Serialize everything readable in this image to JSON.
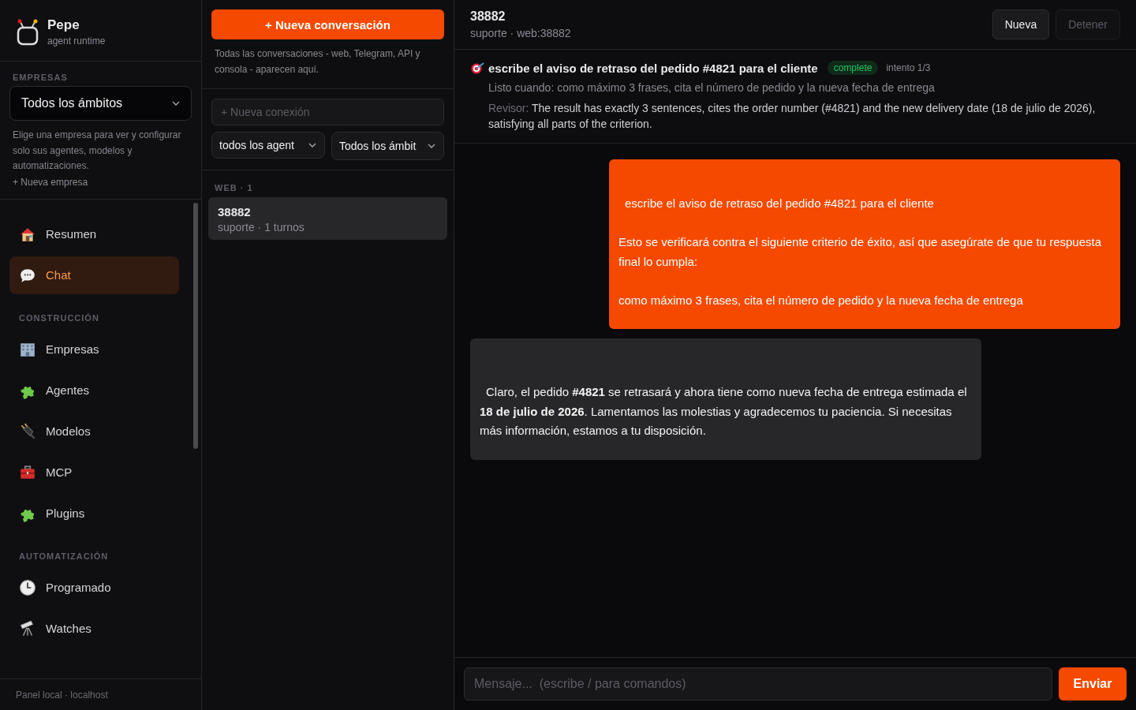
{
  "brand": {
    "name": "Pepe",
    "subtitle": "agent runtime"
  },
  "companies": {
    "heading": "EMPRESAS",
    "select": "Todos los ámbitos",
    "help": "Elige una empresa para ver y configurar solo sus agentes, modelos y automatizaciones.",
    "new_link": "+ Nueva empresa"
  },
  "nav": [
    {
      "items": [
        {
          "label": "Resumen",
          "selected": false
        },
        {
          "label": "Chat",
          "selected": true
        }
      ]
    },
    {
      "heading": "CONSTRUCCIÓN",
      "items": [
        {
          "label": "Empresas",
          "selected": false
        },
        {
          "label": "Agentes",
          "selected": false
        },
        {
          "label": "Modelos",
          "selected": false
        },
        {
          "label": "MCP",
          "selected": false
        },
        {
          "label": "Plugins",
          "selected": false
        }
      ]
    },
    {
      "heading": "AUTOMATIZACIÓN",
      "items": [
        {
          "label": "Programado",
          "selected": false
        },
        {
          "label": "Watches",
          "selected": false
        }
      ]
    }
  ],
  "sidebar_footer": "Panel local · localhost",
  "conversations": {
    "new_button": "+ Nueva conversación",
    "note": "Todas las conversaciones - web, Telegram, API y consola - aparecen aquí.",
    "connection_placeholder": "+ Nueva conexión",
    "filters": [
      "todos los agent",
      "Todos los ámbit"
    ],
    "groups": [
      {
        "heading": "WEB · 1",
        "items": [
          {
            "title": "38882",
            "subtitle": "suporte · 1 turnos",
            "selected": true
          }
        ]
      }
    ]
  },
  "chat": {
    "title": "38882",
    "subtitle": "suporte · web:38882",
    "buttons": [
      {
        "label": "Nueva",
        "disabled": false
      },
      {
        "label": "Detener",
        "disabled": true
      }
    ],
    "goal": {
      "text": "escribe el aviso de retraso del pedido #4821 para el cliente",
      "status": "complete",
      "attempt": "intento 1/3",
      "ready_label": "Listo cuando:",
      "ready": "como máximo 3 frases, cita el número de pedido y la nueva fecha de entrega",
      "reviewer_label": "Revisor:",
      "reviewer": "The result has exactly 3 sentences, cites the order number (#4821) and the new delivery date (18 de julio de 2026), satisfying all parts of the criterion."
    },
    "messages": [
      {
        "kind": "user",
        "paragraphs": [
          "escribe el aviso de retraso del pedido #4821 para el cliente",
          "Esto se verificará contra el siguiente criterio de éxito, así que asegúrate de que tu respuesta final lo cumpla:",
          "como máximo 3 frases, cita el número de pedido y la nueva fecha de entrega"
        ]
      },
      {
        "kind": "assistant",
        "paragraphs": [
          "Claro, el pedido **#4821** se retrasará y ahora tiene como nueva fecha de entrega estimada el **18 de julio de 2026**. Lamentamos las molestias y agradecemos tu paciencia. Si necesitas más información, estamos a tu disposición."
        ]
      }
    ],
    "input_placeholder": "Mensaje...  (escribe / para comandos)",
    "send": "Enviar"
  }
}
